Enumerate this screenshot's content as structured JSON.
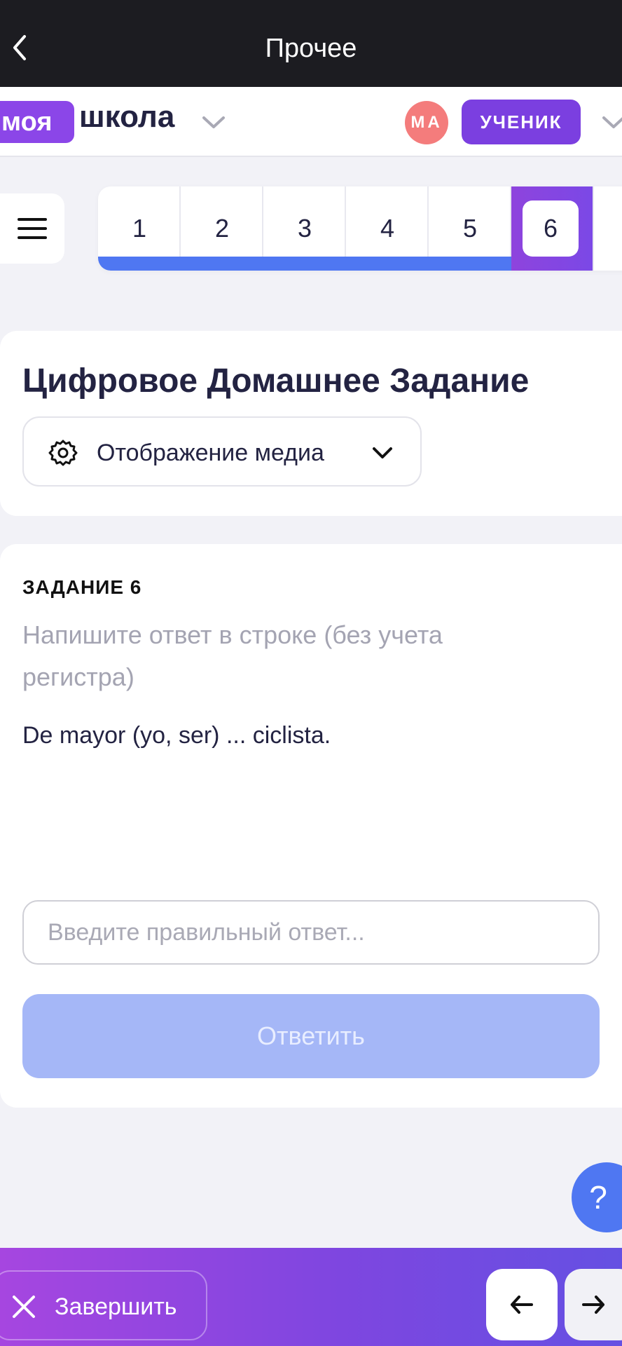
{
  "topbar": {
    "title": "Прочее"
  },
  "header": {
    "logo_badge": "моя",
    "logo_word": "школа",
    "avatar_initials": "МА",
    "role": "УЧЕНИК"
  },
  "tasks": {
    "items": [
      "1",
      "2",
      "3",
      "4",
      "5",
      "6"
    ],
    "active": "6"
  },
  "title_card": {
    "title": "Цифровое Домашнее Задание",
    "media_label": "Отображение медиа"
  },
  "task": {
    "heading": "ЗАДАНИЕ 6",
    "hint": "Напишите ответ в строке (без учета регистра)",
    "question": "De mayor (yo, ser) ... ciclista.",
    "input_placeholder": "Введите правильный ответ...",
    "input_value": "",
    "submit_label": "Ответить"
  },
  "help": {
    "label": "?"
  },
  "bottombar": {
    "finish_label": "Завершить"
  },
  "colors": {
    "accent": "#8b46e8",
    "progress": "#4f77f2",
    "topbar": "#1c1c21",
    "submit_disabled": "#a5b7f7"
  }
}
